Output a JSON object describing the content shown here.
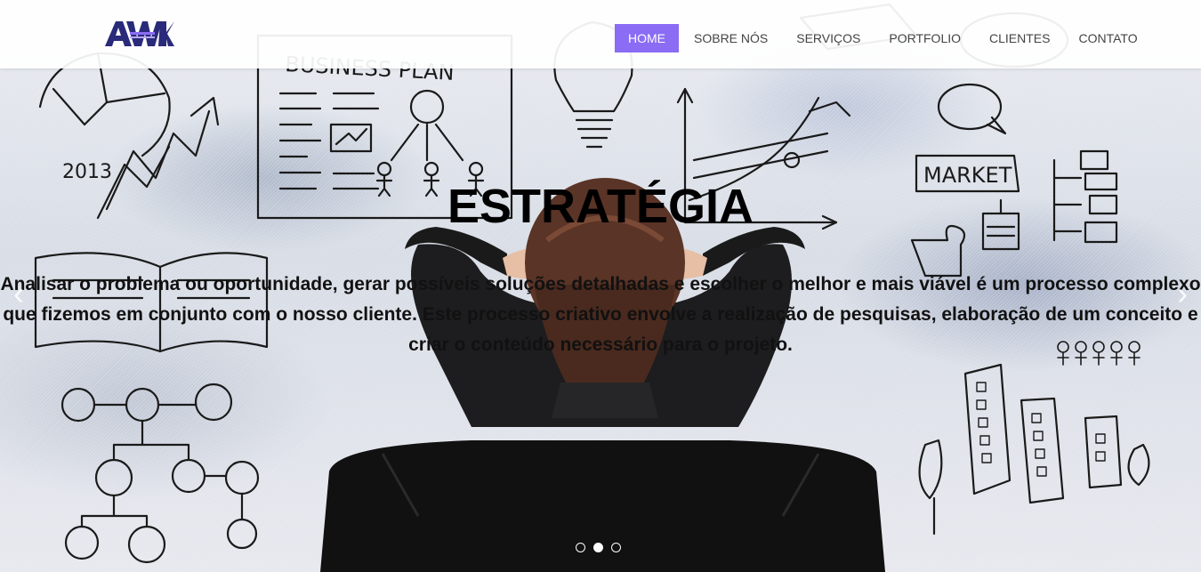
{
  "brand": {
    "logo_text": "AWK",
    "accent_color": "#8a6cf5"
  },
  "nav": {
    "items": [
      {
        "label": "HOME",
        "active": true
      },
      {
        "label": "SOBRE NÓS",
        "active": false
      },
      {
        "label": "SERVIÇOS",
        "active": false
      },
      {
        "label": "PORTFOLIO",
        "active": false
      },
      {
        "label": "CLIENTES",
        "active": false
      },
      {
        "label": "CONTATO",
        "active": false
      }
    ]
  },
  "slide": {
    "title": "ESTRATÉGIA",
    "description": "Analisar o problema ou oportunidade, gerar possíveis soluções detalhadas e escolher o melhor e mais viável é um processo complexo que fizemos em conjunto com o nosso cliente. Este processo criativo envolve a realização de pesquisas, elaboração de um conceito e criar o conteúdo necessário para o projeto."
  },
  "sketch_labels": {
    "business_plan": "BUSINESS PLAN",
    "year": "2013",
    "market": "MARKET"
  },
  "carousel": {
    "slides": 3,
    "active_index": 1
  }
}
